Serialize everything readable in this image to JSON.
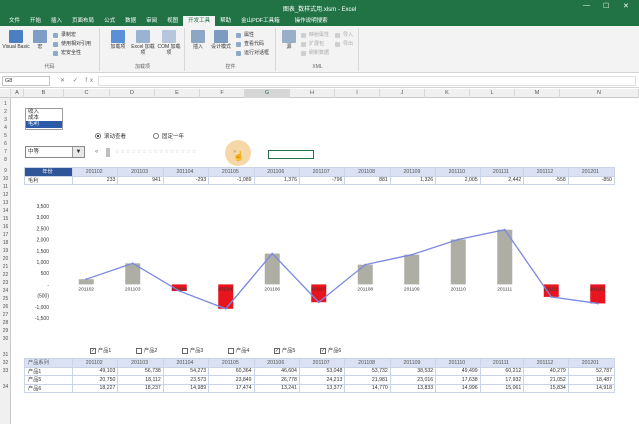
{
  "window": {
    "title": "图表_数样式用.xlsm - Excel",
    "min": "—",
    "max": "☐",
    "close": "✕"
  },
  "tabs": [
    "文件",
    "开始",
    "插入",
    "页面布局",
    "公式",
    "数据",
    "审阅",
    "视图",
    "开发工具",
    "帮助",
    "金山PDF工具箱"
  ],
  "active_tab": "开发工具",
  "tell_me": "操作说明搜索",
  "ribbon": {
    "code": {
      "label": "代码",
      "vb": "Visual Basic",
      "macro": "宏",
      "record": "录制宏",
      "relative": "使用相对引用",
      "security": "宏安全性"
    },
    "addins": {
      "label": "加载项",
      "addin": "加载项",
      "excel_addin": "Excel 加载项",
      "com_addin": "COM 加载项"
    },
    "controls": {
      "label": "控件",
      "insert": "插入",
      "design": "设计模式",
      "props": "属性",
      "viewcode": "查看代码",
      "dialog": "运行对话框"
    },
    "xml": {
      "label": "XML",
      "source": "源",
      "map": "映射属性",
      "expand": "扩展包",
      "refresh": "刷新数据",
      "import": "导入",
      "export": "导出"
    }
  },
  "namebox": "G8",
  "fx": "✕ ✓ fx",
  "columns": [
    "A",
    "B",
    "C",
    "D",
    "E",
    "F",
    "G",
    "H",
    "I",
    "J",
    "K",
    "L",
    "M",
    "N"
  ],
  "rows": [
    "1",
    "2",
    "3",
    "4",
    "5",
    "6",
    "7",
    "8",
    "9",
    "10",
    "11",
    "12",
    "13",
    "14",
    "15",
    "16",
    "17",
    "18",
    "19",
    "20",
    "21",
    "22",
    "23",
    "24",
    "25",
    "26",
    "27",
    "28",
    "29",
    "30",
    "31",
    "32",
    "33",
    "34"
  ],
  "listbox": {
    "items": [
      "收入",
      "成本",
      "毛利"
    ],
    "selected": 2
  },
  "radios": [
    {
      "label": "滚动查看",
      "checked": true
    },
    {
      "label": "固定一年",
      "checked": false
    }
  ],
  "combo": {
    "value": "中等",
    "arrow": "▼"
  },
  "scroll": {
    "left": "«",
    "right": "»",
    "ticks": "☆☆☆☆☆☆☆☆☆☆☆☆☆☆☆"
  },
  "top_table": {
    "header": [
      "年份",
      "201102",
      "201103",
      "201104",
      "201105",
      "201106",
      "201107",
      "201108",
      "201109",
      "201110",
      "201111",
      "201112",
      "201201"
    ],
    "row": [
      "毛利",
      "233",
      "941",
      "-293",
      "-1,089",
      "1,376",
      "-796",
      "881",
      "1,326",
      "2,005",
      "2,442",
      "-558",
      "-850"
    ]
  },
  "chart_data": {
    "type": "bar",
    "categories": [
      "201102",
      "201103",
      "201104",
      "201105",
      "201106",
      "201107",
      "201108",
      "201109",
      "201110",
      "201111",
      "201112",
      "201201"
    ],
    "series": [
      {
        "values": [
          233,
          941,
          -293,
          -1089,
          1376,
          -796,
          881,
          1326,
          2005,
          2442,
          -558,
          -850
        ]
      }
    ],
    "ylim": [
      -1500,
      3500
    ],
    "yticks": [
      "3,500",
      "3,000",
      "2,500",
      "2,000",
      "1,500",
      "1,000",
      "500",
      "-",
      "(500)",
      "-1,000",
      "-1,500"
    ],
    "positive_color": "#aeaea4",
    "negative_color": "#e8141e",
    "line_color": "#7b88e0",
    "grid": false
  },
  "checkboxes": [
    {
      "label": "产品1",
      "checked": true
    },
    {
      "label": "产品2",
      "checked": false
    },
    {
      "label": "产品3",
      "checked": false
    },
    {
      "label": "产品4",
      "checked": false
    },
    {
      "label": "产品5",
      "checked": true
    },
    {
      "label": "产品6",
      "checked": true
    }
  ],
  "bottom_table": {
    "header": [
      "产品系列",
      "201102",
      "201103",
      "201104",
      "201105",
      "201106",
      "201107",
      "201108",
      "201109",
      "201110",
      "201111",
      "201112",
      "201201"
    ],
    "rows": [
      [
        "产品1",
        "49,103",
        "56,738",
        "54,273",
        "60,364",
        "46,604",
        "53,048",
        "53,732",
        "38,532",
        "49,499",
        "60,212",
        "40,279",
        "52,787"
      ],
      [
        "产品5",
        "20,750",
        "18,112",
        "23,573",
        "23,849",
        "26,778",
        "24,213",
        "21,981",
        "23,016",
        "17,638",
        "17,932",
        "21,052",
        "18,487"
      ],
      [
        "产品6",
        "18,227",
        "18,237",
        "14,989",
        "17,474",
        "13,241",
        "13,377",
        "14,770",
        "13,833",
        "14,996",
        "15,061",
        "15,834",
        "14,918"
      ]
    ]
  }
}
